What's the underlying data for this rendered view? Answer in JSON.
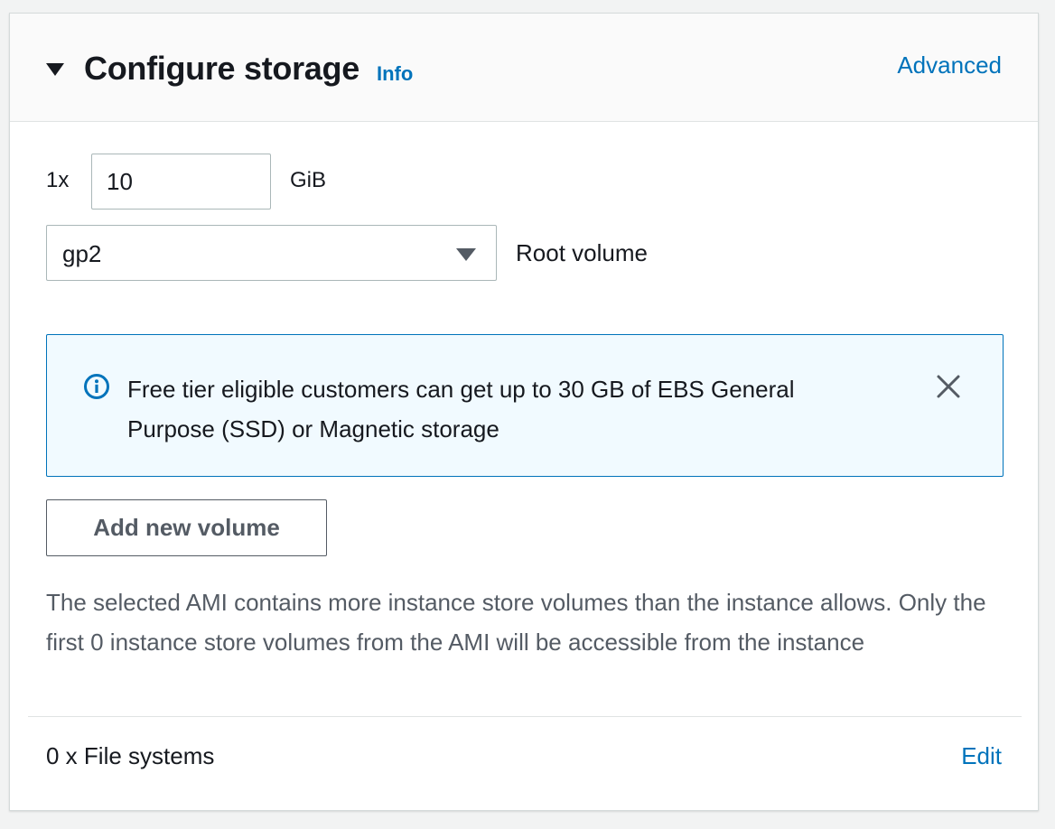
{
  "header": {
    "title": "Configure storage",
    "info_label": "Info",
    "advanced_label": "Advanced"
  },
  "volume": {
    "quantity_label": "1x",
    "size_value": "10",
    "unit_label": "GiB",
    "type_selected": "gp2",
    "role_label": "Root volume"
  },
  "alert": {
    "message": "Free tier eligible customers can get up to 30 GB of EBS General Purpose (SSD) or Magnetic storage"
  },
  "actions": {
    "add_volume_label": "Add new volume"
  },
  "note": {
    "text": "The selected AMI contains more instance store volumes than the instance allows. Only the first 0 instance store volumes from the AMI will be accessible from the instance"
  },
  "file_systems": {
    "label": "0 x File systems",
    "edit_label": "Edit"
  },
  "colors": {
    "link": "#0073bb",
    "alert_background": "#f1faff",
    "alert_border": "#0073bb",
    "text_primary": "#16191f",
    "text_secondary": "#545b64"
  },
  "icons": {
    "collapse": "caret-down-icon",
    "select_arrow": "chevron-down-icon",
    "alert": "info-circle-icon",
    "dismiss": "close-icon"
  }
}
